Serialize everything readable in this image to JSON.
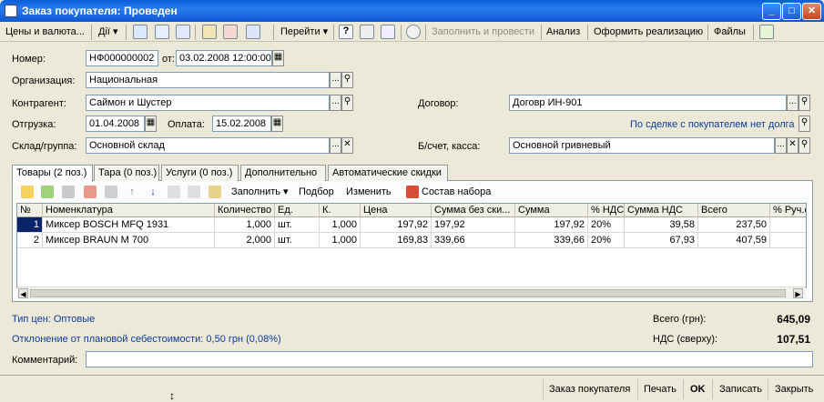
{
  "window": {
    "title": "Заказ покупателя: Проведен",
    "min": "_",
    "max": "□",
    "close": "✕"
  },
  "toolbar": {
    "prices_currency": "Цены и валюта...",
    "actions": "Дії ▾",
    "goto": "Перейти ▾",
    "help": "?",
    "fill_and_post": "Заполнить и провести",
    "analysis": "Анализ",
    "make_sale": "Оформить реализацию",
    "files": "Файлы"
  },
  "header": {
    "number_label": "Номер:",
    "number_value": "НФ000000002",
    "date_label": "от:",
    "date_value": "03.02.2008 12:00:00",
    "org_label": "Организация:",
    "org_value": "Национальная",
    "counterparty_label": "Контрагент:",
    "counterparty_value": "Саймон и Шустер",
    "contract_label": "Договор:",
    "contract_value": "Договр ИН-901",
    "shipment_label": "Отгрузка:",
    "shipment_value": "01.04.2008",
    "payment_label": "Оплата:",
    "payment_value": "15.02.2008",
    "deal_link": "По сделке с покупателем нет долга",
    "warehouse_label": "Склад/группа:",
    "warehouse_value": "Основной склад",
    "account_label": "Б/счет, касса:",
    "account_value": "Основной гривневый",
    "dots": "...",
    "clear": "✕"
  },
  "tabs": [
    {
      "label": "Товары (2 поз.)"
    },
    {
      "label": "Тара (0 поз.)"
    },
    {
      "label": "Услуги (0 поз.)"
    },
    {
      "label": "Дополнительно"
    },
    {
      "label": "Автоматические скидки"
    }
  ],
  "grid_toolbar": {
    "fill": "Заполнить ▾",
    "selection": "Подбор",
    "change": "Изменить",
    "kit": "Состав набора"
  },
  "grid": {
    "columns": [
      "№",
      "Номенклатура",
      "Количество",
      "Ед.",
      "К.",
      "Цена",
      "Сумма без ски...",
      "Сумма",
      "% НДС",
      "Сумма НДС",
      "Всего",
      "% Руч.ск"
    ],
    "rows": [
      [
        "1",
        "Миксер BOSCH MFQ 1931",
        "1,000",
        "шт.",
        "1,000",
        "197,92",
        "197,92",
        "197,92",
        "20%",
        "39,58",
        "237,50",
        ""
      ],
      [
        "2",
        "Миксер BRAUN M 700",
        "2,000",
        "шт.",
        "1,000",
        "169,83",
        "339,66",
        "339,66",
        "20%",
        "67,93",
        "407,59",
        ""
      ]
    ]
  },
  "summary": {
    "price_type": "Тип цен: Оптовые",
    "deviation": "Отклонение от плановой себестоимости: 0,50 грн (0,08%)",
    "total_label": "Всего (грн):",
    "total_value": "645,09",
    "vat_label": "НДС (сверху):",
    "vat_value": "107,51",
    "comment_label": "Комментарий:",
    "comment_value": ""
  },
  "footer": {
    "order": "Заказ покупателя",
    "print": "Печать",
    "ok": "OK",
    "save": "Записать",
    "close": "Закрыть"
  }
}
